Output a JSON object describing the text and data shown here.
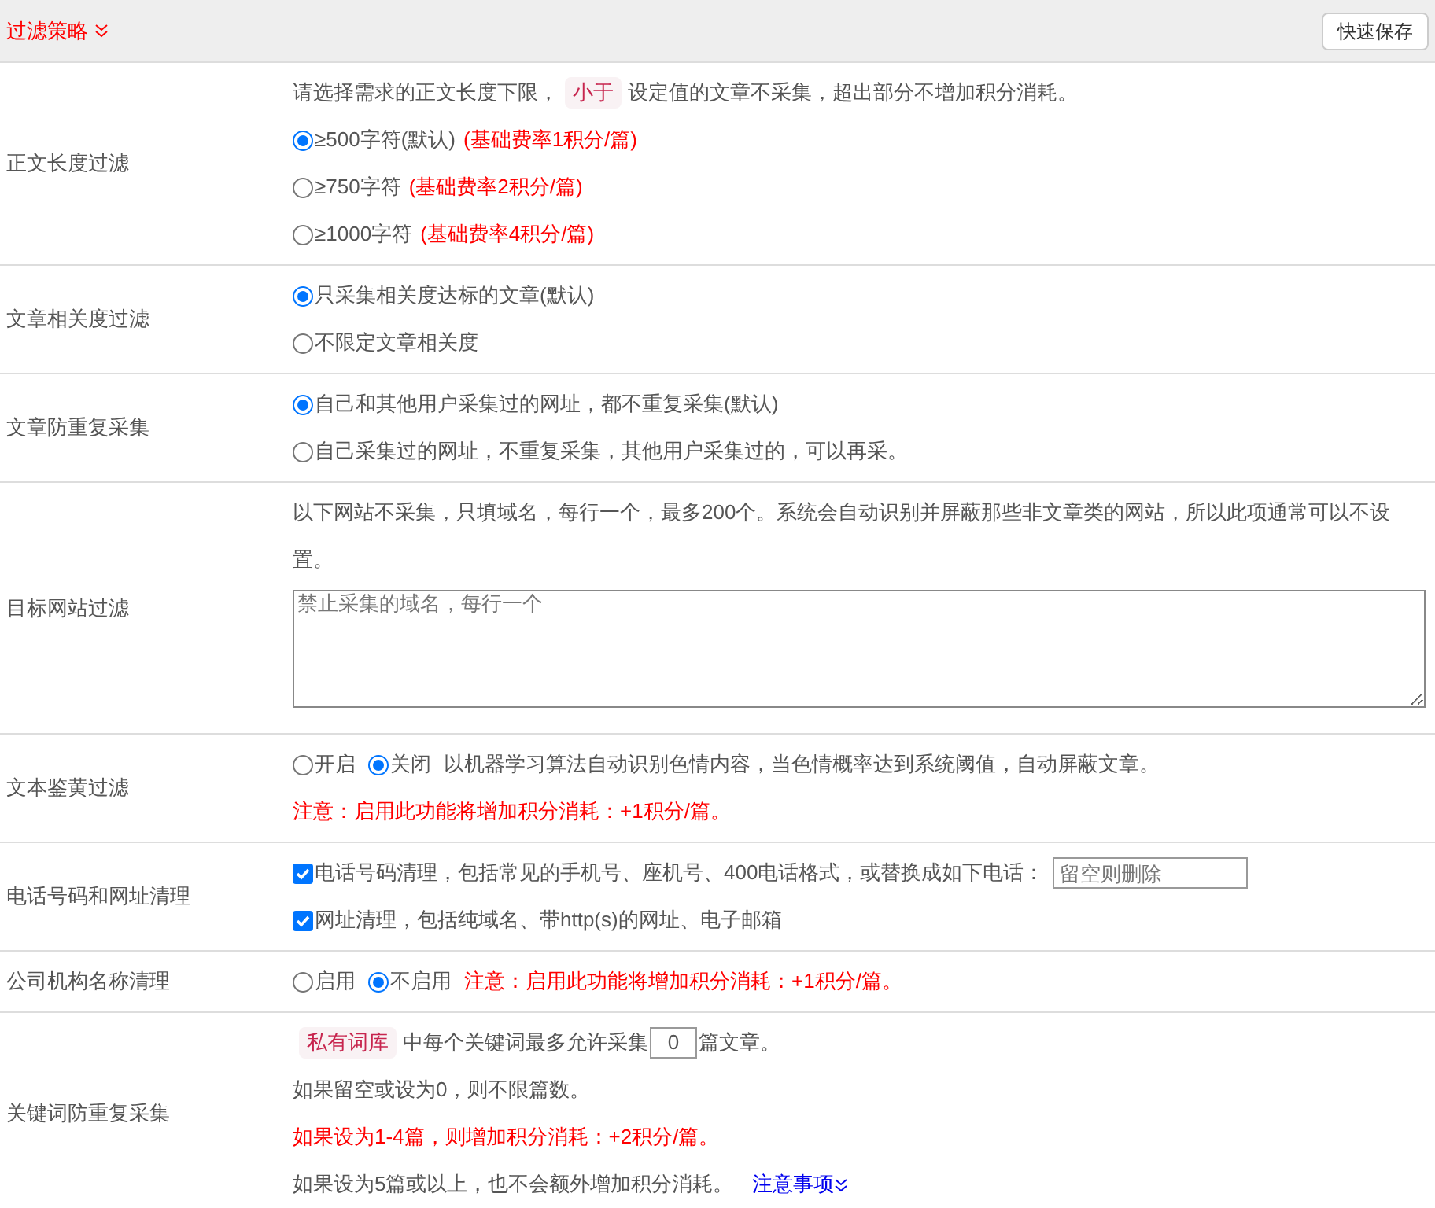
{
  "header": {
    "title": "过滤策略",
    "expanded": true,
    "save_button": "快速保存"
  },
  "rows": [
    {
      "label": "正文长度过滤",
      "lines": [
        {
          "kind": "note",
          "parts": [
            {
              "kind": "text",
              "text": "请选择需求的正文长度下限，"
            },
            {
              "kind": "tag",
              "text": "小于"
            },
            {
              "kind": "text",
              "text": "设定值的文章不采集，超出部分不增加积分消耗。"
            }
          ]
        },
        {
          "kind": "radio",
          "selected": true,
          "text": "≥500字符(默认)",
          "extra": "(基础费率1积分/篇)"
        },
        {
          "kind": "radio",
          "selected": false,
          "text": "≥750字符",
          "extra": "(基础费率2积分/篇)"
        },
        {
          "kind": "radio",
          "selected": false,
          "text": "≥1000字符",
          "extra": "(基础费率4积分/篇)"
        }
      ]
    },
    {
      "label": "文章相关度过滤",
      "lines": [
        {
          "kind": "radio",
          "selected": true,
          "text": "只采集相关度达标的文章(默认)"
        },
        {
          "kind": "radio",
          "selected": false,
          "text": "不限定文章相关度"
        }
      ]
    },
    {
      "label": "文章防重复采集",
      "lines": [
        {
          "kind": "radio",
          "selected": true,
          "text": "自己和其他用户采集过的网址，都不重复采集(默认)"
        },
        {
          "kind": "radio",
          "selected": false,
          "text": "自己采集过的网址，不重复采集，其他用户采集过的，可以再采。"
        }
      ]
    },
    {
      "label": "目标网站过滤",
      "lines": [
        {
          "kind": "note",
          "parts": [
            {
              "kind": "text",
              "text": "以下网站不采集，只填域名，每行一个，最多200个。系统会自动识别并屏蔽那些非文章类的网站，所以此项通常可以不设置。"
            }
          ]
        },
        {
          "kind": "textarea",
          "placeholder": "禁止采集的域名，每行一个"
        }
      ]
    },
    {
      "label": "文本鉴黄过滤",
      "lines": [
        {
          "kind": "radios",
          "options": [
            {
              "text": "开启",
              "selected": false
            },
            {
              "text": "关闭",
              "selected": true
            }
          ],
          "extra": {
            "kind": "note",
            "text": "以机器学习算法自动识别色情内容，当色情概率达到系统阈值，自动屏蔽文章。"
          }
        },
        {
          "kind": "warning",
          "text": "注意：启用此功能将增加积分消耗：+1积分/篇。"
        }
      ]
    },
    {
      "label": "电话号码和网址清理",
      "lines": [
        {
          "kind": "checkbox",
          "checked": true,
          "text": "电话号码清理，包括常见的手机号、座机号、400电话格式，或替换成如下电话：",
          "placeholder": "留空则删除"
        },
        {
          "kind": "checkbox",
          "checked": true,
          "text": "网址清理，包括纯域名、带http(s)的网址、电子邮箱"
        }
      ]
    },
    {
      "label": "公司机构名称清理",
      "lines": [
        {
          "kind": "radios",
          "options": [
            {
              "text": "启用",
              "selected": false
            },
            {
              "text": "不启用",
              "selected": true
            }
          ],
          "extra": {
            "kind": "warning",
            "text": "注意：启用此功能将增加积分消耗：+1积分/篇。"
          }
        }
      ]
    },
    {
      "label": "关键词防重复采集",
      "lines": [
        {
          "kind": "note",
          "parts": [
            {
              "kind": "tag",
              "text": "私有词库"
            },
            {
              "kind": "text",
              "text": "中每个关键词最多允许采集"
            },
            {
              "kind": "input",
              "text": "0"
            },
            {
              "kind": "text",
              "text": "篇文章。"
            }
          ]
        },
        {
          "kind": "note",
          "parts": [
            {
              "kind": "text",
              "text": "如果留空或设为0，则不限篇数。"
            }
          ]
        },
        {
          "kind": "warning",
          "text": "如果设为1-4篇，则增加积分消耗：+2积分/篇。"
        },
        {
          "kind": "note",
          "parts": [
            {
              "kind": "text",
              "text": "如果设为5篇或以上，也不会额外增加积分消耗。"
            }
          ],
          "link": "注意事项"
        }
      ]
    }
  ]
}
